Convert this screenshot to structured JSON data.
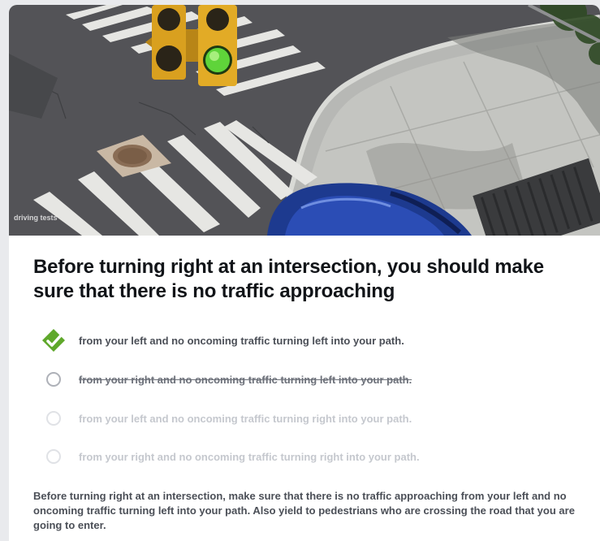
{
  "question": {
    "image": {
      "alt": "Intersection with green traffic light, crosswalks and a blue car turning at the corner",
      "watermark": "driving tests"
    },
    "text": "Before turning right at an intersection, you should make sure that there is no traffic approaching",
    "options": [
      {
        "text": "from your left and no oncoming traffic turning left into your path.",
        "state": "correct",
        "icon": "checkmark-diamond-icon"
      },
      {
        "text": "from your right and no oncoming traffic turning left into your path.",
        "state": "eliminated",
        "icon": "radio-circle-icon"
      },
      {
        "text": "from your left and no oncoming traffic turning right into your path.",
        "state": "faded",
        "icon": "radio-circle-icon"
      },
      {
        "text": "from your right and no oncoming traffic turning right into your path.",
        "state": "faded",
        "icon": "radio-circle-icon"
      }
    ],
    "explanation": "Before turning right at an intersection, make sure that there is no traffic approaching from your left and no oncoming traffic turning left into your path. Also yield to pedestrians who are crossing the road that you are going to enter."
  },
  "colors": {
    "correct_green": "#5fa82b",
    "text_dark": "#111418",
    "text_body": "#4b4f57",
    "text_faded": "#c5c8ce",
    "page_background": "#e9eaed",
    "card_background": "#ffffff"
  }
}
